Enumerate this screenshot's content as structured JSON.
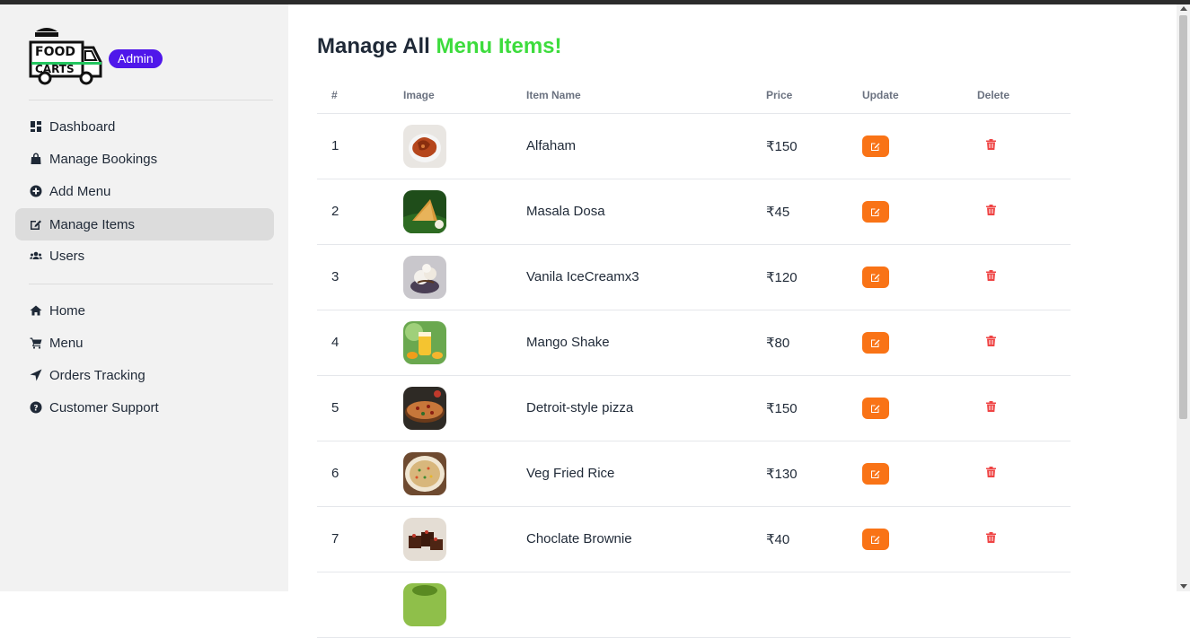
{
  "brand": {
    "logo_line1": "FOOD",
    "logo_line2": "CARTS",
    "badge": "Admin"
  },
  "sidebar": {
    "admin_items": [
      {
        "label": "Dashboard",
        "icon": "dashboard-icon"
      },
      {
        "label": "Manage Bookings",
        "icon": "shopping-bag-icon"
      },
      {
        "label": "Add Menu",
        "icon": "plus-circle-icon"
      },
      {
        "label": "Manage Items",
        "icon": "edit-icon",
        "active": true
      },
      {
        "label": "Users",
        "icon": "users-icon"
      }
    ],
    "site_items": [
      {
        "label": "Home",
        "icon": "home-icon"
      },
      {
        "label": "Menu",
        "icon": "cart-icon"
      },
      {
        "label": "Orders Tracking",
        "icon": "location-arrow-icon"
      },
      {
        "label": "Customer Support",
        "icon": "question-circle-icon"
      }
    ]
  },
  "page": {
    "title_prefix": "Manage All",
    "title_highlight": "Menu Items!",
    "accent": "#3ddc3d"
  },
  "table": {
    "headers": [
      "#",
      "Image",
      "Item Name",
      "Price",
      "Update",
      "Delete"
    ],
    "rows": [
      {
        "num": "1",
        "name": "Alfaham",
        "price": "₹150"
      },
      {
        "num": "2",
        "name": "Masala Dosa",
        "price": "₹45"
      },
      {
        "num": "3",
        "name": "Vanila IceCreamx3",
        "price": "₹120"
      },
      {
        "num": "4",
        "name": "Mango Shake",
        "price": "₹80"
      },
      {
        "num": "5",
        "name": "Detroit-style pizza",
        "price": "₹150"
      },
      {
        "num": "6",
        "name": "Veg Fried Rice",
        "price": "₹130"
      },
      {
        "num": "7",
        "name": "Choclate Brownie",
        "price": "₹40"
      },
      {
        "num": "",
        "name": "",
        "price": ""
      }
    ]
  },
  "colors": {
    "update_button": "#f97316",
    "delete_icon": "#ef4444",
    "admin_badge": "#4f17ea"
  }
}
